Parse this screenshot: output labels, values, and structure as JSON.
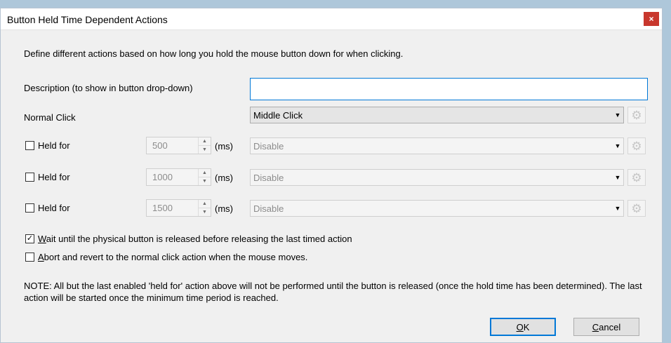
{
  "window": {
    "title": "Button Held Time Dependent Actions",
    "close_glyph": "×"
  },
  "intro": "Define different actions based on how long you hold the mouse button down for when clicking.",
  "description": {
    "label": "Description (to show in button drop-down)",
    "value": ""
  },
  "normal_click": {
    "label": "Normal Click",
    "selected": "Middle Click"
  },
  "held_rows": [
    {
      "checked": false,
      "label": "Held for",
      "ms_value": "500",
      "unit": "(ms)",
      "action": "Disable"
    },
    {
      "checked": false,
      "label": "Held for",
      "ms_value": "1000",
      "unit": "(ms)",
      "action": "Disable"
    },
    {
      "checked": false,
      "label": "Held for",
      "ms_value": "1500",
      "unit": "(ms)",
      "action": "Disable"
    }
  ],
  "options": {
    "wait_release": {
      "checked": true,
      "mnemonic": "W",
      "rest": "ait until the physical button is released before releasing the last timed action"
    },
    "abort_move": {
      "checked": false,
      "mnemonic": "A",
      "rest": "bort and revert to the normal click action when the mouse moves."
    }
  },
  "note": "NOTE: All but the last enabled 'held for' action above will not be performed until the button is released (once the hold time has been determined). The last action will be started once the minimum time period is reached.",
  "buttons": {
    "ok": {
      "mnemonic": "O",
      "rest": "K"
    },
    "cancel": {
      "mnemonic": "C",
      "rest": "ancel"
    }
  },
  "icons": {
    "dropdown_arrow": "▼",
    "spin_up": "▲",
    "spin_down": "▼",
    "gear": "⚙",
    "check": "✓"
  },
  "colors": {
    "accent": "#0078d7",
    "close": "#c8372d",
    "dialog_bg": "#f0f0f0"
  }
}
